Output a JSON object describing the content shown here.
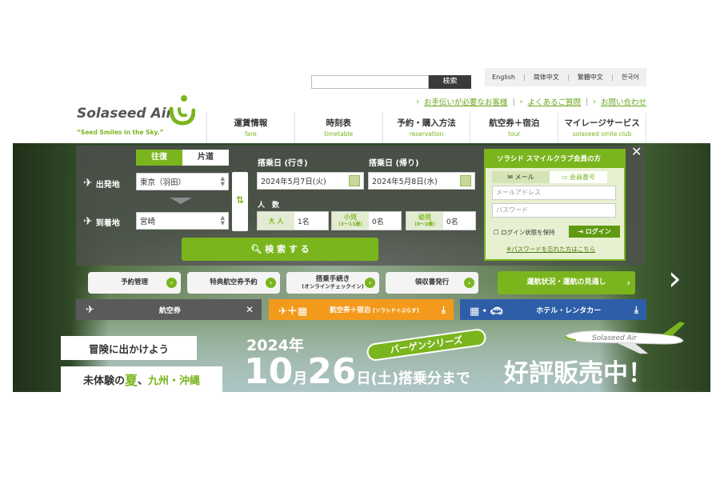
{
  "header": {
    "search_button": "検索",
    "search_placeholder": "",
    "languages": [
      "English",
      "简体中文",
      "繁體中文",
      "한국어"
    ],
    "help_links": [
      "お手伝いが必要なお客様",
      "よくあるご質問",
      "お問い合わせ"
    ]
  },
  "logo": {
    "name": "Solaseed Air",
    "tagline": "“Seed Smiles in the Sky.”"
  },
  "nav": [
    {
      "label": "運賃情報",
      "sub": "fare"
    },
    {
      "label": "時刻表",
      "sub": "timetable"
    },
    {
      "label": "予約・購入方法",
      "sub": "reservation"
    },
    {
      "label": "航空券＋宿泊",
      "sub": "tour"
    },
    {
      "label": "マイレージサービス",
      "sub": "solaseed smile club"
    }
  ],
  "booking": {
    "trip_tabs": [
      "往復",
      "片道"
    ],
    "departure_label": "出発地",
    "departure_value": "東京（羽田）",
    "arrival_label": "到着地",
    "arrival_value": "宮崎",
    "outbound_label": "搭乗日 (行き)",
    "outbound_value": "2024年5月7日(火)",
    "return_label": "搭乗日 (帰り)",
    "return_value": "2024年5月8日(水)",
    "passengers_label": "人　数",
    "adult_label": "大 人",
    "adult_value": "1名",
    "child_label": "小児",
    "child_age": "(3〜11歳)",
    "child_value": "0名",
    "infant_label": "幼児",
    "infant_age": "(0〜2歳)",
    "infant_value": "0名",
    "search_button": "検 索 す る"
  },
  "member": {
    "title": "ソラシド スマイルクラブ会員の方",
    "tab_mail": "メール",
    "tab_number": "会員番号",
    "mail_placeholder": "メールアドレス",
    "password_placeholder": "パスワード",
    "keep_login": "ログイン状態を保持",
    "login_button": "ログイン",
    "forgot": "※パスワードを忘れた方はこちら"
  },
  "quick_buttons": [
    {
      "label": "予約管理"
    },
    {
      "label": "特典航空券予約"
    },
    {
      "label": "搭乗手続き",
      "sub": "(オンラインチェックイン)"
    },
    {
      "label": "領収書発行"
    }
  ],
  "status_button": "運航状況・運航の見通し",
  "categories": {
    "air": "航空券",
    "tour": "航空券＋宿泊",
    "tour_sub": "[ソラシド＋ぷらす]",
    "hotel": "ホテル・レンタカー"
  },
  "banner": {
    "adventure": "冒険に出かけよう",
    "summer_pre": "未体験の",
    "summer_kanji": "夏",
    "summer_mid": "、",
    "summer_region": "九州・沖縄",
    "year": "2024年",
    "bargain": "バーゲンシリーズ",
    "date_month": "10",
    "date_m": "月",
    "date_day": "26",
    "date_rest": "日(土)搭乗分まで",
    "sale": "好評販売中！",
    "plane_text": "Solaseed Air"
  },
  "colors": {
    "accent": "#7ab51d",
    "tour": "#f39a1c",
    "hotel": "#2e5ea8"
  }
}
